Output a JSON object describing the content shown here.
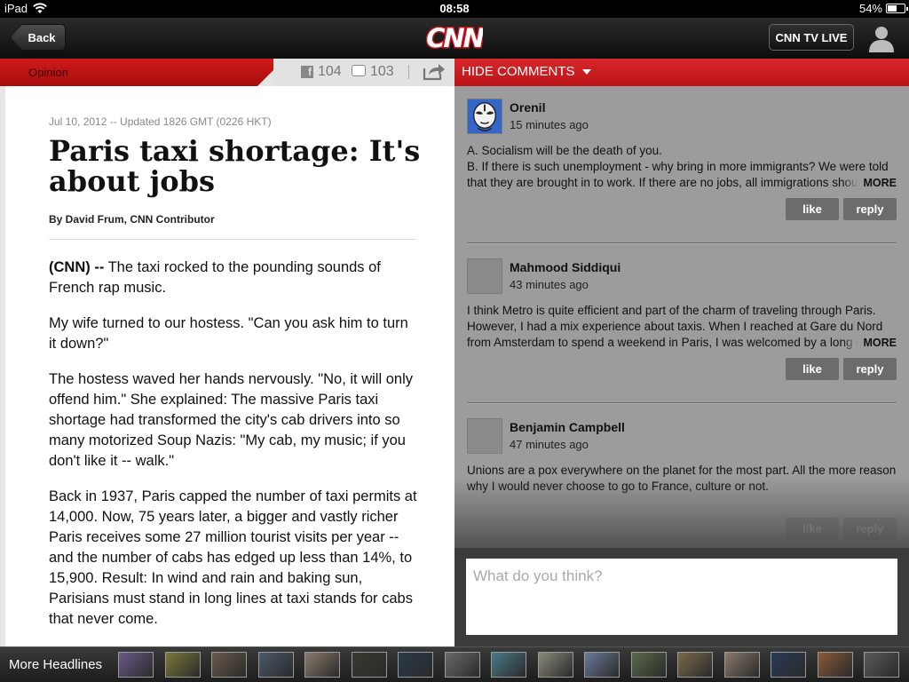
{
  "status_bar": {
    "device": "iPad",
    "time": "08:58",
    "battery": "54%",
    "battery_level": 0.54
  },
  "nav": {
    "back_label": "Back",
    "logo": "CNN",
    "tv_live_label": "CNN TV LIVE"
  },
  "article": {
    "section": "Opinion",
    "facebook_count": "104",
    "comment_count": "103",
    "dateline": "Jul 10, 2012 -- Updated 1826 GMT (0226 HKT)",
    "headline": "Paris taxi shortage: It's about jobs",
    "byline": "By David Frum, CNN Contributor",
    "lead_tag": "(CNN) --",
    "lead_text": " The taxi rocked to the pounding sounds of French rap music.",
    "paragraphs": [
      "My wife turned to our hostess. \"Can you ask him to turn it down?\"",
      "The hostess waved her hands nervously. \"No, it will only offend him.\" She explained: The massive Paris taxi shortage had transformed the city's cab drivers into so many motorized Soup Nazis: \"My cab, my music; if you don't like it -- walk.\"",
      "Back in 1937, Paris capped the number of taxi permits at 14,000. Now, 75 years later, a bigger and vastly richer Paris receives some 27 million tourist visits per year -- and the number of cabs has edged up less than 14%, to 15,900. Result: In wind and rain and baking sun, Parisians must stand in long lines at taxi stands for cabs that never come."
    ]
  },
  "comments": {
    "toggle_label": "HIDE COMMENTS",
    "more_label": "MORE",
    "like_label": "like",
    "reply_label": "reply",
    "items": [
      {
        "author": "Orenil",
        "time": "15 minutes ago",
        "text": "A. Socialism will be the death of you.\nB. If there is such unemployment - why bring in more immigrants? We were told that they are brought in to work. If there are no jobs, all immigrations should stop."
      },
      {
        "author": "Mahmood Siddiqui",
        "time": "43 minutes ago",
        "text": "I think Metro is quite efficient and part of the charm of traveling through Paris. However, I had a mix experience about taxis. When I reached at Gare du Nord from Amsterdam to spend a weekend in Paris, I was welcomed by a long queue."
      },
      {
        "author": "Benjamin Campbell",
        "time": "47 minutes ago",
        "text": "Unions are a pox everywhere on the planet for the most part. All the more reason why I would never choose to go to France, culture or not."
      }
    ],
    "compose_placeholder": "What do you think?"
  },
  "headlines": {
    "label": "More Headlines",
    "thumb_colors": [
      "#6a5a8a",
      "#7a7a3a",
      "#6b5b4b",
      "#4a5a6a",
      "#8a7a6a",
      "#3a3a30",
      "#2a3a4a",
      "#6a6a6a",
      "#4a7a8a",
      "#8a8a7a",
      "#6a7a9a",
      "#5a6a4a",
      "#7a6a4a",
      "#8a7a6a",
      "#2a3a5a",
      "#8a5a3a",
      "#5a5a5a"
    ]
  }
}
